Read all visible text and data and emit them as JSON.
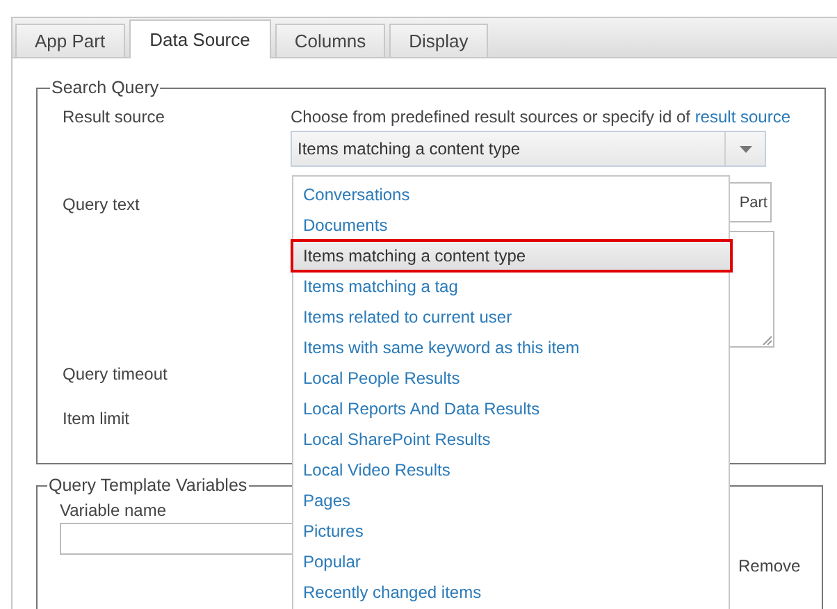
{
  "tabs": [
    {
      "label": "App Part",
      "selected": false
    },
    {
      "label": "Data Source",
      "selected": true
    },
    {
      "label": "Columns",
      "selected": false
    },
    {
      "label": "Display",
      "selected": false
    }
  ],
  "search_query": {
    "legend": "Search Query",
    "result_source": {
      "label": "Result source",
      "description": "Choose from predefined result sources or specify id of ",
      "link": "result source",
      "value": "Items matching a content type"
    },
    "query_text": {
      "label": "Query text",
      "button": "Part"
    },
    "query_timeout": {
      "label": "Query timeout"
    },
    "item_limit": {
      "label": "Item limit"
    }
  },
  "query_template_variables": {
    "legend": "Query Template Variables",
    "variable_name": {
      "label": "Variable name"
    },
    "remove": "Remove"
  },
  "dropdown_options": [
    {
      "label": "Conversations",
      "selected": false
    },
    {
      "label": "Documents",
      "selected": false
    },
    {
      "label": "Items matching a content type",
      "selected": true
    },
    {
      "label": "Items matching a tag",
      "selected": false
    },
    {
      "label": "Items related to current user",
      "selected": false
    },
    {
      "label": "Items with same keyword as this item",
      "selected": false
    },
    {
      "label": "Local People Results",
      "selected": false
    },
    {
      "label": "Local Reports And Data Results",
      "selected": false
    },
    {
      "label": "Local SharePoint Results",
      "selected": false
    },
    {
      "label": "Local Video Results",
      "selected": false
    },
    {
      "label": "Pages",
      "selected": false
    },
    {
      "label": "Pictures",
      "selected": false
    },
    {
      "label": "Popular",
      "selected": false
    },
    {
      "label": "Recently changed items",
      "selected": false
    }
  ]
}
